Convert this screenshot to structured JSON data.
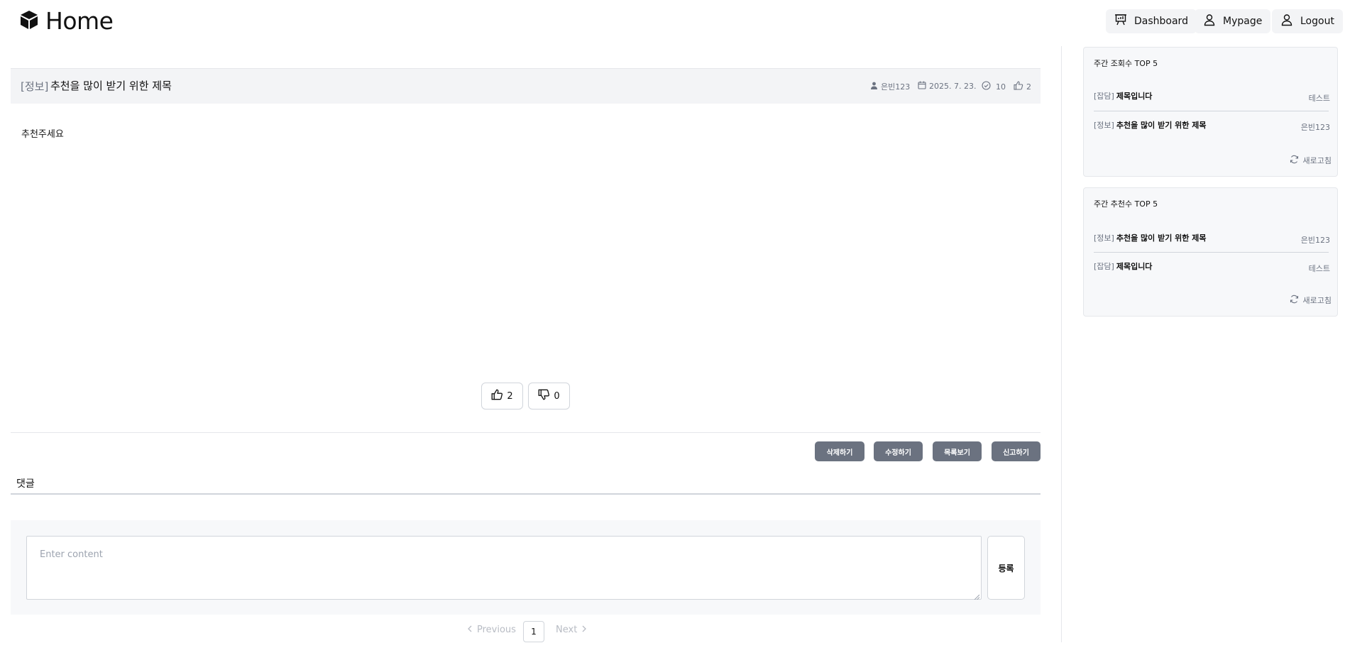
{
  "header": {
    "logo_text": "Home",
    "nav": {
      "dashboard": "Dashboard",
      "mypage": "Mypage",
      "logout": "Logout"
    }
  },
  "post": {
    "category": "[정보]",
    "title": "추천을 많이 받기 위한 제목",
    "author": "은빈123",
    "date": "2025. 7. 23.",
    "views": "10",
    "likes": "2",
    "body": "추천주세요",
    "vote_up": "2",
    "vote_down": "0"
  },
  "actions": {
    "delete": "삭제하기",
    "edit": "수정하기",
    "list": "목록보기",
    "report": "신고하기"
  },
  "comments": {
    "title": "댓글",
    "placeholder": "Enter content",
    "submit": "등록"
  },
  "pagination": {
    "previous": "Previous",
    "current": "1",
    "next": "Next"
  },
  "sidebar": {
    "weekly_views": {
      "title": "주간 조회수 TOP 5",
      "items": [
        {
          "category": "[잡담]",
          "title": "제목입니다",
          "author": "테스트"
        },
        {
          "category": "[정보]",
          "title": "추천을 많이 받기 위한 제목",
          "author": "은빈123"
        }
      ],
      "refresh": "새로고침"
    },
    "weekly_likes": {
      "title": "주간 추천수 TOP 5",
      "items": [
        {
          "category": "[정보]",
          "title": "추천을 많이 받기 위한 제목",
          "author": "은빈123"
        },
        {
          "category": "[잡담]",
          "title": "제목입니다",
          "author": "테스트"
        }
      ],
      "refresh": "새로고침"
    }
  },
  "colors": {
    "action_button": "#6b7280",
    "post_bar": "#f3f4f6",
    "panel_bg": "#f7f8fa"
  }
}
